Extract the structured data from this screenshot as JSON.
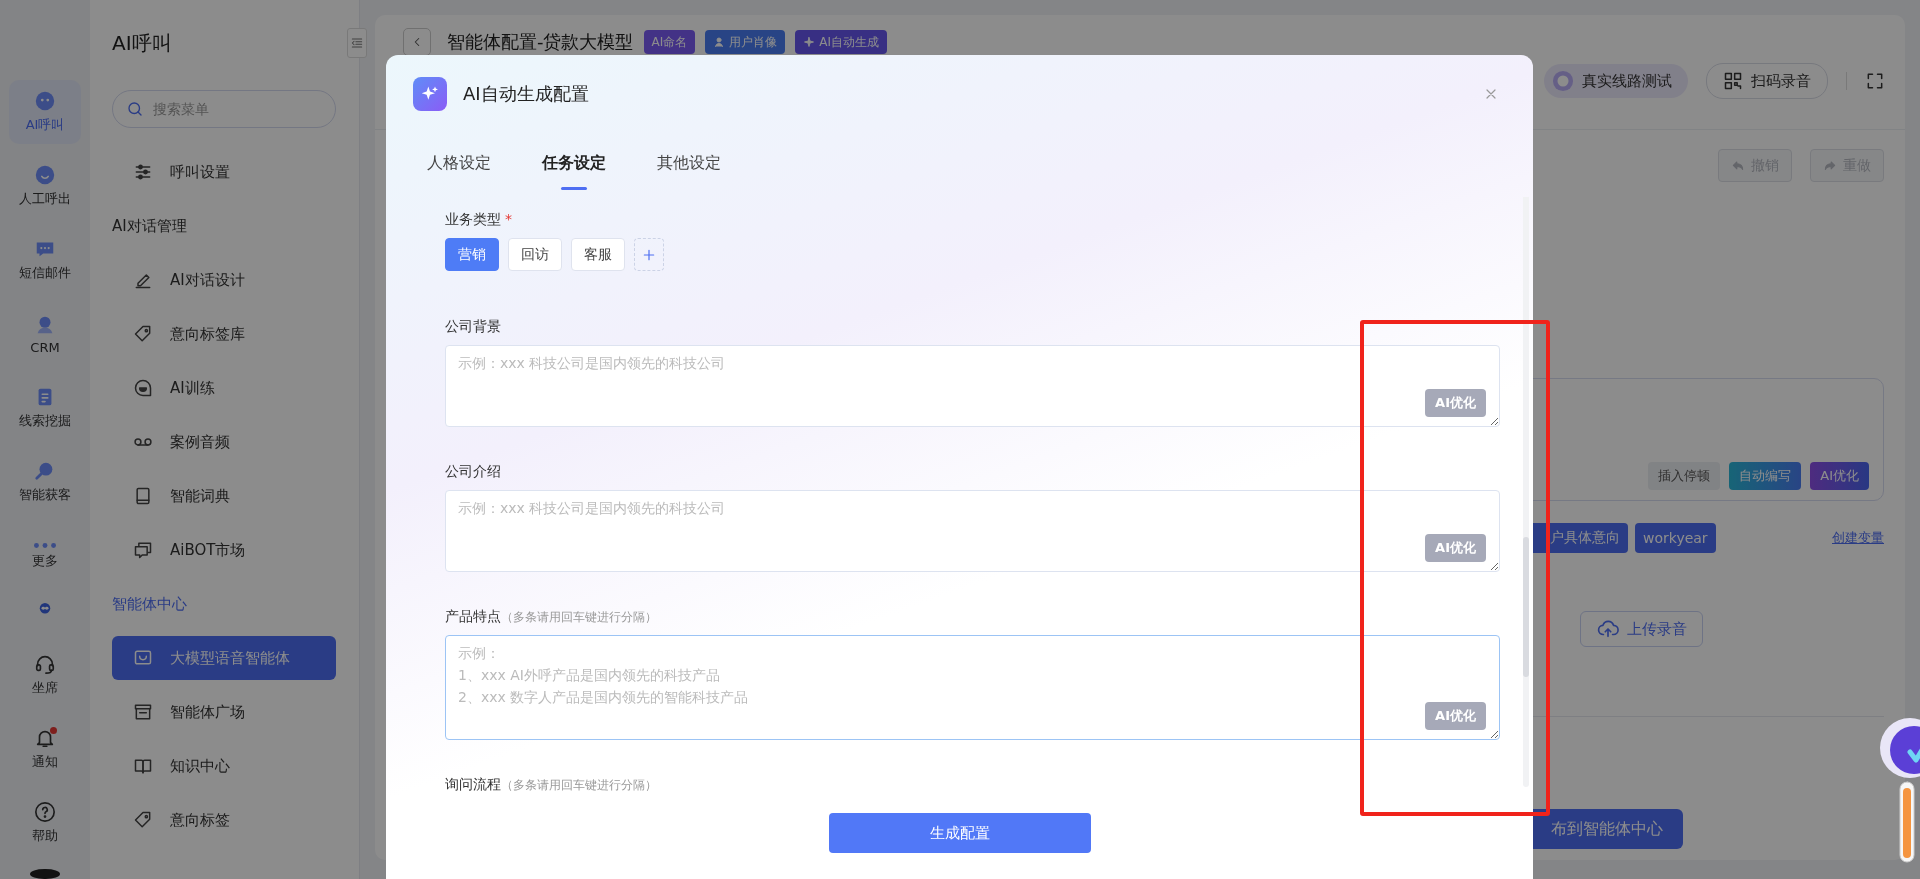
{
  "rail": {
    "top_items": [
      {
        "label": "AI呼叫",
        "selected": true
      },
      {
        "label": "人工呼出",
        "selected": false
      },
      {
        "label": "短信邮件",
        "selected": false
      },
      {
        "label": "CRM",
        "selected": false
      },
      {
        "label": "线索挖掘",
        "selected": false
      },
      {
        "label": "智能获客",
        "selected": false
      },
      {
        "label": "更多",
        "selected": false
      }
    ],
    "bottom_items": [
      {
        "label": "坐席",
        "selected": false,
        "unread": false
      },
      {
        "label": "通知",
        "selected": false,
        "unread": true
      },
      {
        "label": "帮助",
        "selected": false,
        "unread": false
      }
    ]
  },
  "sidebar": {
    "title": "AI呼叫",
    "search": {
      "placeholder": "搜索菜单"
    },
    "groups": [
      {
        "items": [
          {
            "label": "呼叫设置",
            "selected": false
          }
        ]
      },
      {
        "heading": "AI对话管理",
        "active": false,
        "items": [
          {
            "label": "AI对话设计",
            "selected": false
          },
          {
            "label": "意向标签库",
            "selected": false
          },
          {
            "label": "AI训练",
            "selected": false
          },
          {
            "label": "案例音频",
            "selected": false
          },
          {
            "label": "智能词典",
            "selected": false
          },
          {
            "label": "AiBOT市场",
            "selected": false
          }
        ]
      },
      {
        "heading": "智能体中心",
        "active": true,
        "items": [
          {
            "label": "大模型语音智能体",
            "selected": true
          },
          {
            "label": "智能体广场",
            "selected": false
          },
          {
            "label": "知识中心",
            "selected": false
          },
          {
            "label": "意向标签",
            "selected": false
          }
        ]
      }
    ]
  },
  "page_header": {
    "title": "智能体配置-贷款大模型",
    "tags": [
      {
        "label": "AI命名"
      },
      {
        "label": "用户肖像"
      },
      {
        "label": "AI自动生成"
      }
    ],
    "actions": [
      "真实线路测试",
      "扫码录音"
    ]
  },
  "history": [
    {
      "label": "撤销",
      "disabled": true
    },
    {
      "label": "重做",
      "disabled": true
    }
  ],
  "script_editor": {
    "buttons": [
      {
        "label": "插入停顿",
        "kind": "plain"
      },
      {
        "label": "自动编写",
        "kind": "teal"
      },
      {
        "label": "AI优化",
        "kind": "violet"
      }
    ]
  },
  "variables": {
    "tags": [
      "户具体意向",
      "workyear"
    ],
    "link": "创建变量"
  },
  "upload_button": "上传录音",
  "publish_button": "布到智能体中心",
  "modal": {
    "title": "AI自动生成配置",
    "tabs": [
      {
        "label": "人格设定",
        "selected": false
      },
      {
        "label": "任务设定",
        "selected": true
      },
      {
        "label": "其他设定",
        "selected": false
      }
    ],
    "fields": [
      {
        "kind": "chips",
        "label": "业务类型",
        "required_mark": "*",
        "chips": [
          {
            "label": "营销",
            "selected": true
          },
          {
            "label": "回访",
            "selected": false
          },
          {
            "label": "客服",
            "selected": false
          }
        ]
      },
      {
        "kind": "textarea",
        "label": "公司背景",
        "placeholder": "示例：xxx 科技公司是国内领先的科技公司",
        "focused": false,
        "action": "AI优化"
      },
      {
        "kind": "textarea",
        "label": "公司介绍",
        "placeholder": "示例：xxx 科技公司是国内领先的科技公司",
        "focused": false,
        "action": "AI优化"
      },
      {
        "kind": "textarea",
        "label": "产品特点",
        "hint": "（多条请用回车键进行分隔）",
        "placeholder": "示例：\n1、xxx AI外呼产品是国内领先的科技产品\n2、xxx 数字人产品是国内领先的智能科技产品",
        "focused": true,
        "action": "AI优化",
        "tall": true
      },
      {
        "kind": "heading",
        "label": "询问流程",
        "hint": "（多条请用回车键进行分隔）"
      }
    ],
    "submit": "生成配置"
  }
}
